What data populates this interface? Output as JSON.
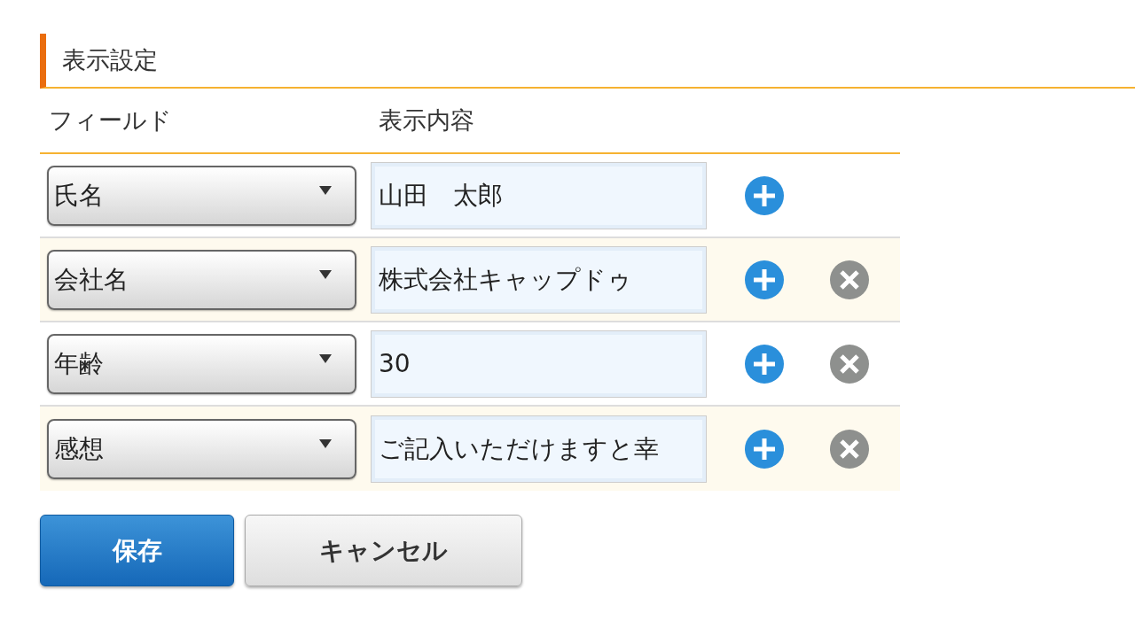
{
  "section_title": "表示設定",
  "columns": [
    "フィールド",
    "表示内容"
  ],
  "rows": [
    {
      "field": "氏名",
      "value": "山田　太郎",
      "removable": false
    },
    {
      "field": "会社名",
      "value": "株式会社キャップドゥ",
      "removable": true
    },
    {
      "field": "年齢",
      "value": "30",
      "removable": true
    },
    {
      "field": "感想",
      "value": "ご記入いただけますと幸",
      "removable": true
    }
  ],
  "buttons": [
    {
      "label": "保存",
      "kind": "primary"
    },
    {
      "label": "キャンセル",
      "kind": "secondary"
    }
  ]
}
